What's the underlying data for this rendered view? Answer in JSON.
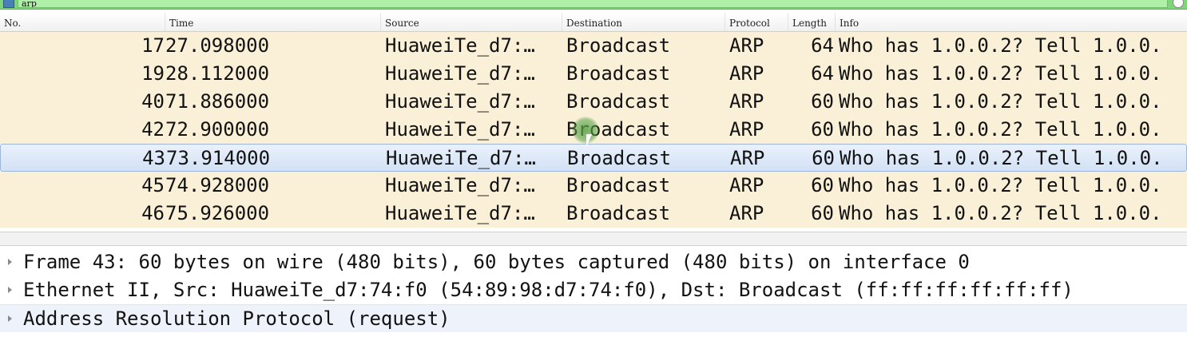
{
  "filter": {
    "value": "arp"
  },
  "columns": {
    "no": "No.",
    "time": "Time",
    "source": "Source",
    "destination": "Destination",
    "protocol": "Protocol",
    "length": "Length",
    "info": "Info"
  },
  "packets": [
    {
      "no": "17",
      "time": "27.098000",
      "source": "HuaweiTe_d7:…",
      "destination": "Broadcast",
      "protocol": "ARP",
      "length": "64",
      "info": "Who has 1.0.0.2? Tell 1.0.0."
    },
    {
      "no": "19",
      "time": "28.112000",
      "source": "HuaweiTe_d7:…",
      "destination": "Broadcast",
      "protocol": "ARP",
      "length": "64",
      "info": "Who has 1.0.0.2? Tell 1.0.0."
    },
    {
      "no": "40",
      "time": "71.886000",
      "source": "HuaweiTe_d7:…",
      "destination": "Broadcast",
      "protocol": "ARP",
      "length": "60",
      "info": "Who has 1.0.0.2? Tell 1.0.0."
    },
    {
      "no": "42",
      "time": "72.900000",
      "source": "HuaweiTe_d7:…",
      "destination": "Broadcast",
      "protocol": "ARP",
      "length": "60",
      "info": "Who has 1.0.0.2? Tell 1.0.0."
    },
    {
      "no": "43",
      "time": "73.914000",
      "source": "HuaweiTe_d7:…",
      "destination": "Broadcast",
      "protocol": "ARP",
      "length": "60",
      "info": "Who has 1.0.0.2? Tell 1.0.0."
    },
    {
      "no": "45",
      "time": "74.928000",
      "source": "HuaweiTe_d7:…",
      "destination": "Broadcast",
      "protocol": "ARP",
      "length": "60",
      "info": "Who has 1.0.0.2? Tell 1.0.0."
    },
    {
      "no": "46",
      "time": "75.926000",
      "source": "HuaweiTe_d7:…",
      "destination": "Broadcast",
      "protocol": "ARP",
      "length": "60",
      "info": "Who has 1.0.0.2? Tell 1.0.0."
    }
  ],
  "details": [
    {
      "text": "Frame 43: 60 bytes on wire (480 bits), 60 bytes captured (480 bits) on interface 0"
    },
    {
      "text": "Ethernet II, Src: HuaweiTe_d7:74:f0 (54:89:98:d7:74:f0), Dst: Broadcast (ff:ff:ff:ff:ff:ff)"
    },
    {
      "text": "Address Resolution Protocol (request)"
    }
  ],
  "colors": {
    "filter_valid": "#7fd67a",
    "row_arp": "#faf0d7",
    "row_selected": "#d2e1f5"
  }
}
